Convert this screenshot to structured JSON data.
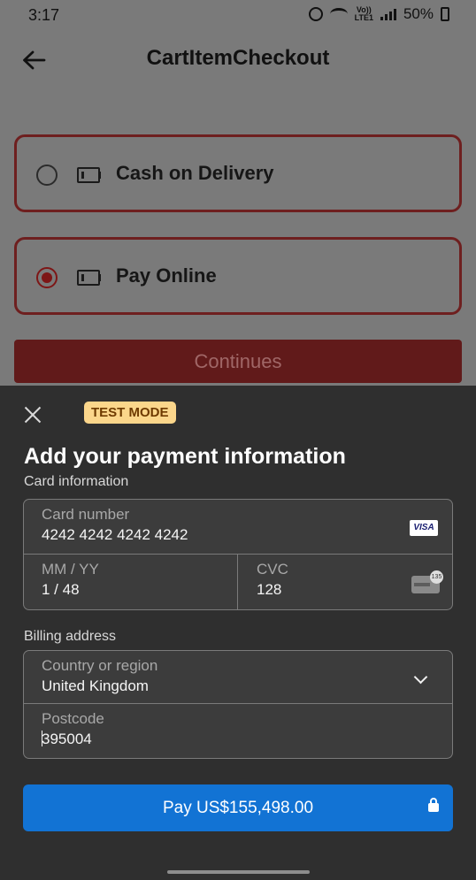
{
  "status_bar": {
    "time": "3:17",
    "volte_top": "Vo))",
    "volte_bottom": "LTE1",
    "battery": "50%"
  },
  "header": {
    "title": "CartItemCheckout",
    "back_icon": "arrow-left-icon"
  },
  "payment_options": [
    {
      "label": "Cash on Delivery",
      "selected": false,
      "icon": "money-icon"
    },
    {
      "label": "Pay Online",
      "selected": true,
      "icon": "money-icon"
    }
  ],
  "continue_label": "Continues",
  "sheet": {
    "test_mode": "TEST MODE",
    "title": "Add your payment information",
    "card_section_label": "Card information",
    "card_number": {
      "label": "Card number",
      "value": "4242 4242 4242 4242",
      "brand": "VISA"
    },
    "expiry": {
      "label": "MM / YY",
      "value": "1 / 48"
    },
    "cvc": {
      "label": "CVC",
      "value": "128",
      "badge": "135"
    },
    "billing_section_label": "Billing address",
    "country": {
      "label": "Country or region",
      "value": "United Kingdom"
    },
    "postcode": {
      "label": "Postcode",
      "value": "395004"
    },
    "pay_label": "Pay US$155,498.00"
  },
  "colors": {
    "accent_red": "#7d1616",
    "pay_blue": "#1273d4",
    "test_badge": "#fbd68b",
    "sheet_bg": "#2f2f2f"
  }
}
